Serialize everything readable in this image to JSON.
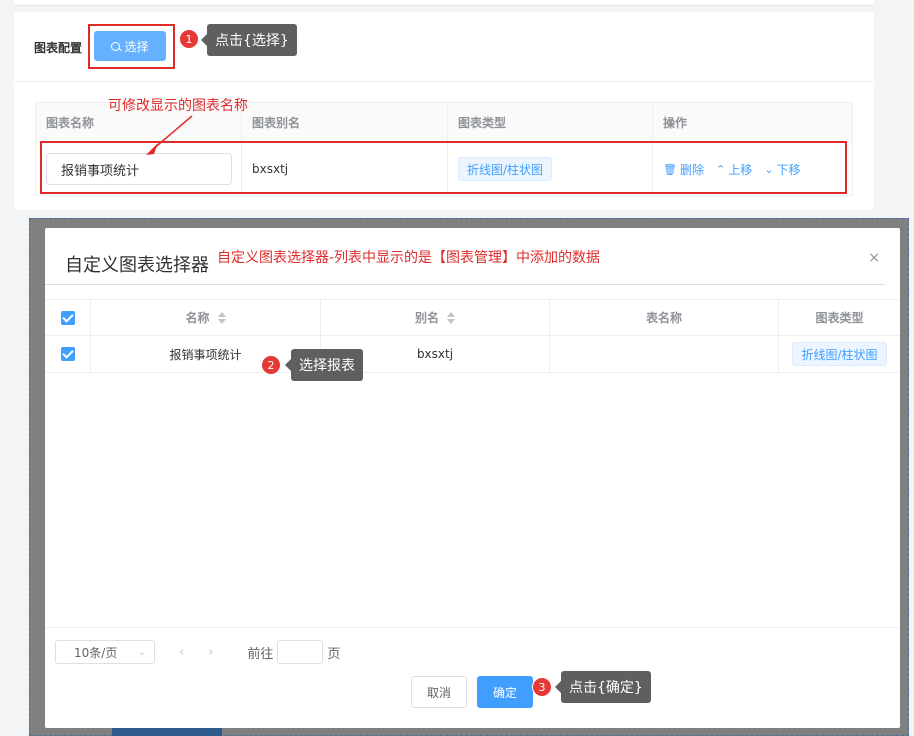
{
  "config": {
    "label": "图表配置",
    "select_button": "选择",
    "columns": [
      "图表名称",
      "图表别名",
      "图表类型",
      "操作"
    ],
    "row": {
      "name": "报销事项统计",
      "alias": "bxsxtj",
      "type": "折线图/柱状图",
      "actions": {
        "delete": "删除",
        "up": "上移",
        "down": "下移"
      }
    }
  },
  "dialog": {
    "title": "自定义图表选择器",
    "close_glyph": "×",
    "columns": [
      "名称",
      "别名",
      "表名称",
      "图表类型"
    ],
    "rows": [
      {
        "name": "报销事项统计",
        "alias": "bxsxtj",
        "table": "",
        "type": "折线图/柱状图",
        "checked": true
      }
    ],
    "pagination": {
      "page_size": "10条/页",
      "goto_label": "前往",
      "page_unit": "页"
    },
    "cancel_label": "取消",
    "confirm_label": "确定"
  },
  "annotations": {
    "rename_hint": "可修改显示的图表名称",
    "dialog_hint": "自定义图表选择器-列表中显示的是【图表管理】中添加的数据",
    "steps": [
      {
        "number": "1",
        "text": "点击{选择}"
      },
      {
        "number": "2",
        "text": "选择报表"
      },
      {
        "number": "3",
        "text": "点击{确定}"
      }
    ]
  },
  "colors": {
    "primary": "#409eff",
    "annotation": "#e02b2b",
    "tooltip": "#5f5f5f"
  }
}
